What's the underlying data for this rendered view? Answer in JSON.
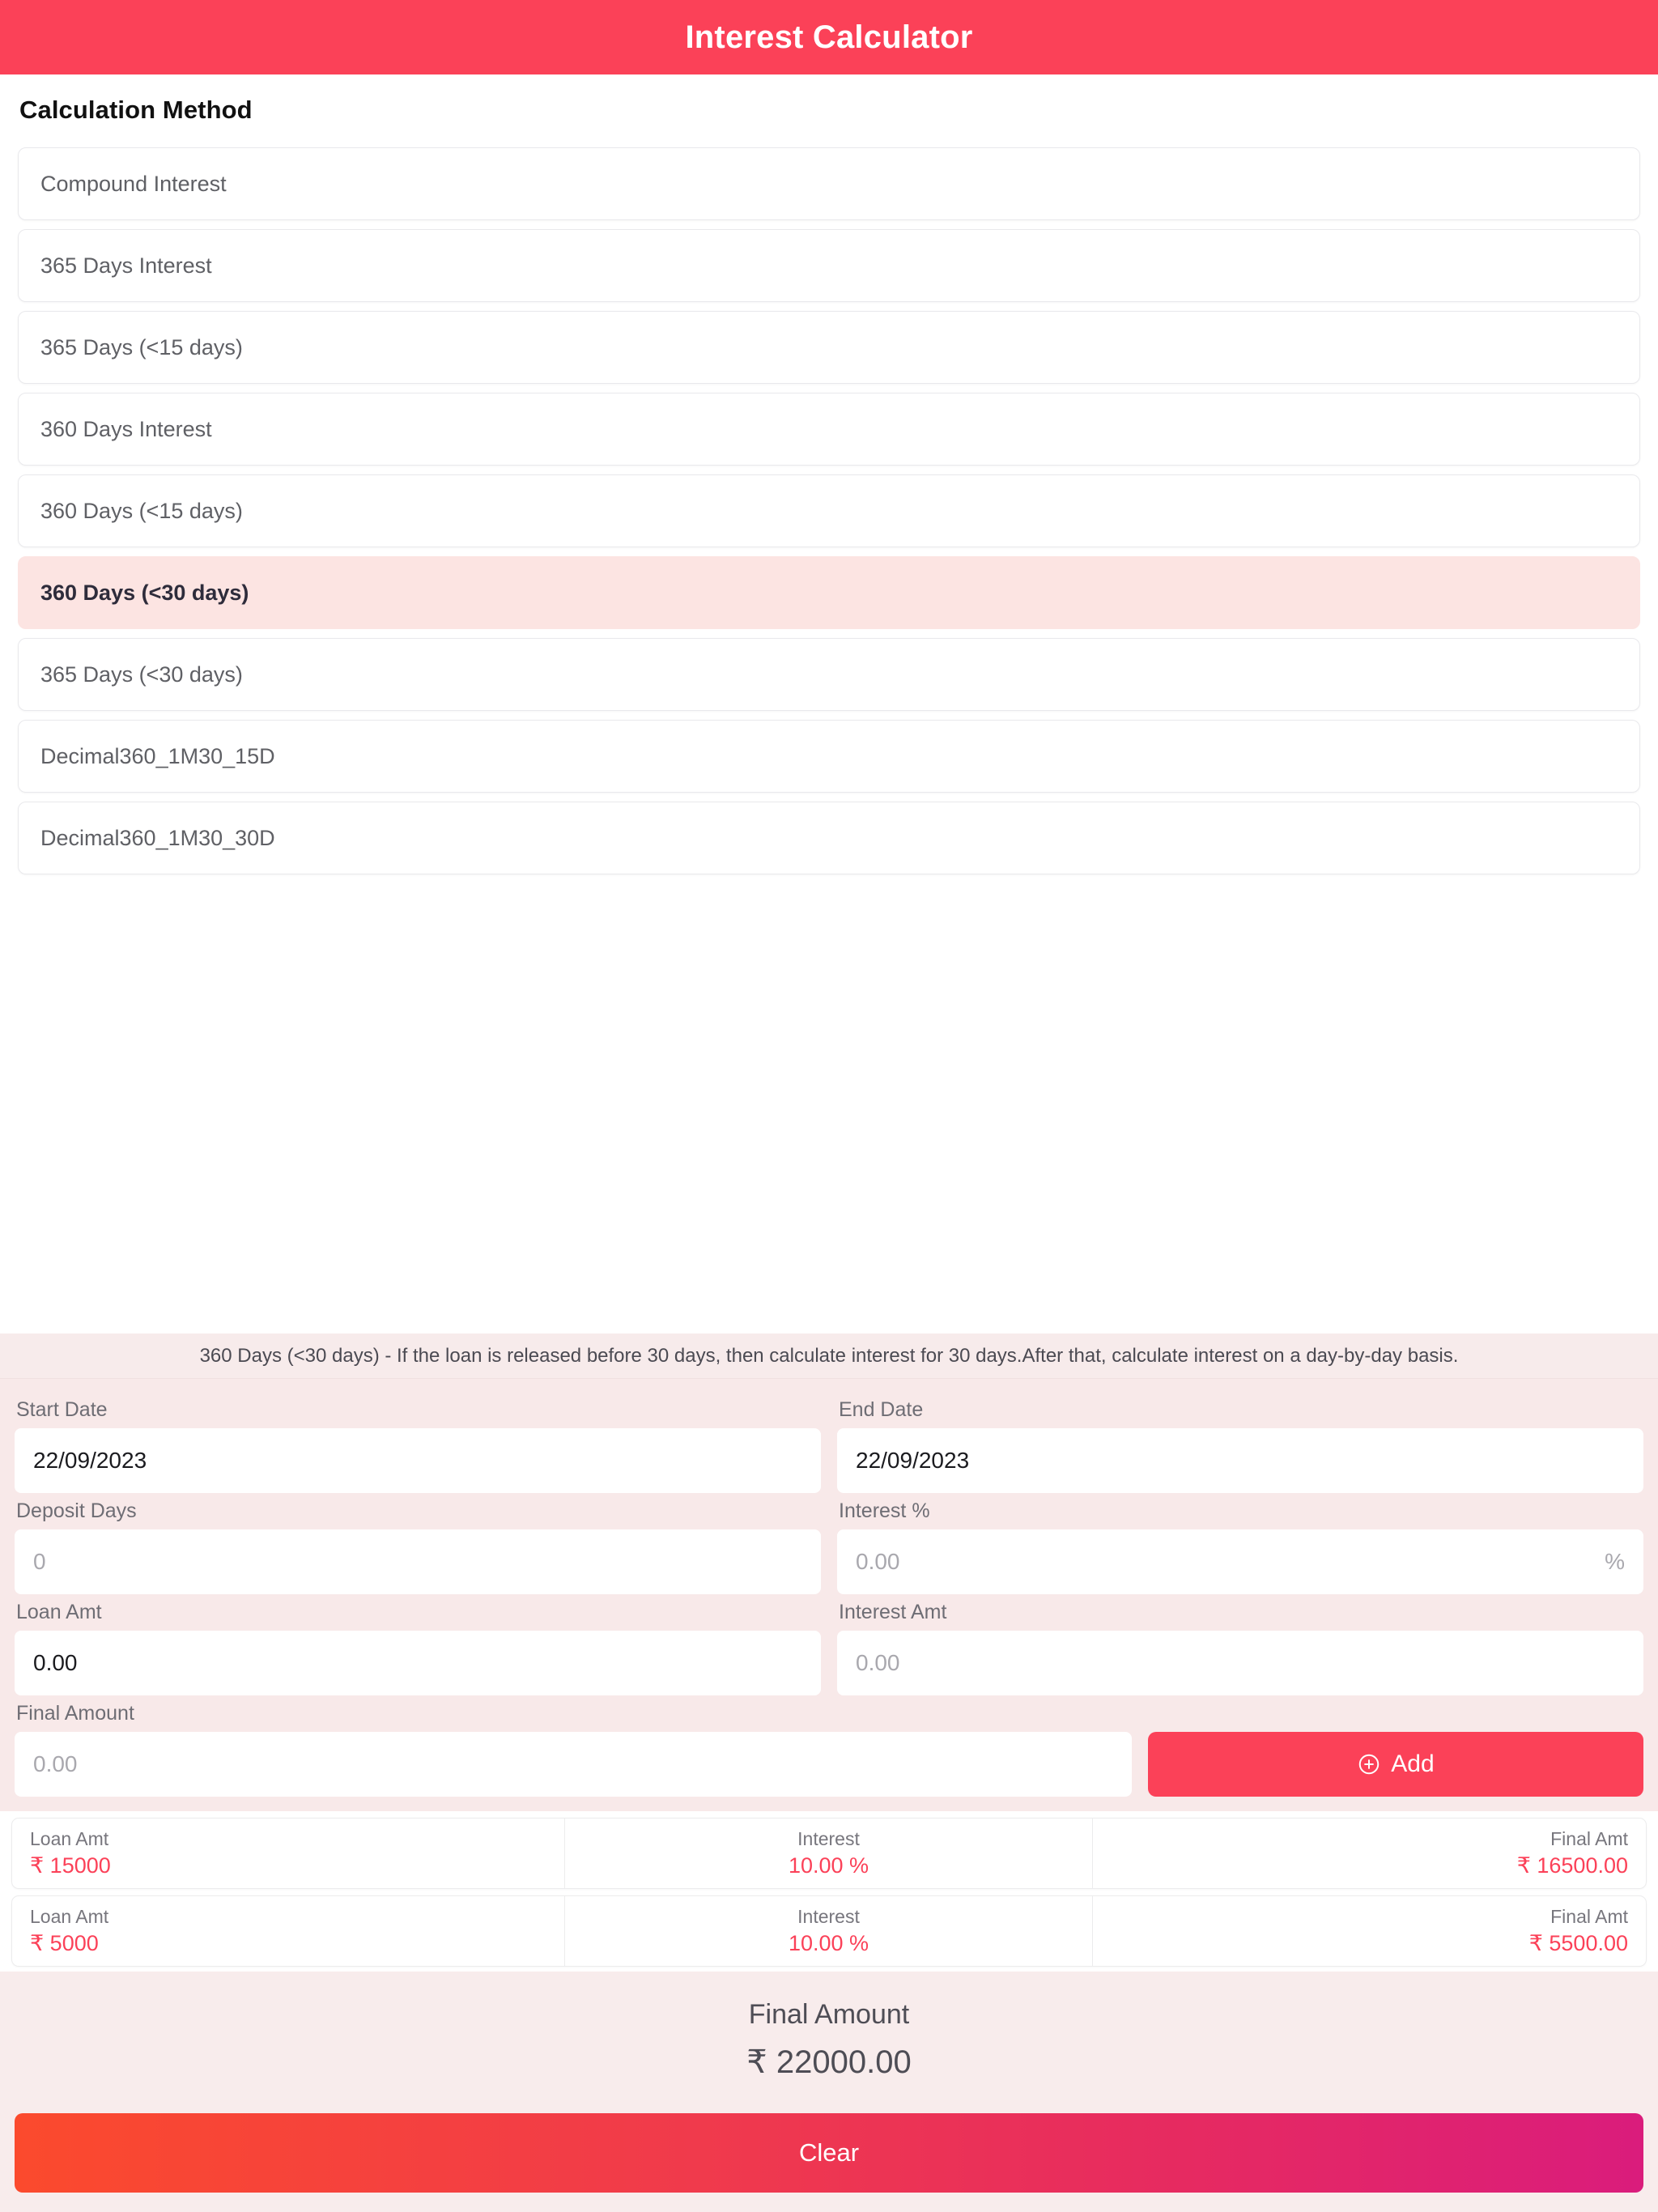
{
  "header": {
    "title": "Interest Calculator",
    "bg_color": "#fb4158"
  },
  "method_section": {
    "heading": "Calculation Method",
    "items": [
      {
        "label": "Compound Interest",
        "selected": false
      },
      {
        "label": "365 Days Interest",
        "selected": false
      },
      {
        "label": "365 Days (<15 days)",
        "selected": false
      },
      {
        "label": "360 Days Interest",
        "selected": false
      },
      {
        "label": "360 Days (<15 days)",
        "selected": false
      },
      {
        "label": "360 Days (<30 days)",
        "selected": true
      },
      {
        "label": "365 Days (<30 days)",
        "selected": false
      },
      {
        "label": "Decimal360_1M30_15D",
        "selected": false
      },
      {
        "label": "Decimal360_1M30_30D",
        "selected": false
      }
    ],
    "selected_label": "360 Days (<30 days)",
    "selected_bg_color": "#fce4e2"
  },
  "description": {
    "text": "360 Days (<30 days) - If the loan is released before 30 days, then calculate interest for 30 days.After that, calculate interest on a day-by-day basis."
  },
  "form": {
    "start_date": {
      "label": "Start Date",
      "value": "22/09/2023",
      "placeholder": ""
    },
    "end_date": {
      "label": "End Date",
      "value": "22/09/2023",
      "placeholder": ""
    },
    "deposit_days": {
      "label": "Deposit Days",
      "value": "",
      "placeholder": "0"
    },
    "interest_pct": {
      "label": "Interest %",
      "value": "",
      "placeholder": "0.00",
      "suffix": "%"
    },
    "loan_amt": {
      "label": "Loan Amt",
      "value": "0.00",
      "placeholder": "0.00"
    },
    "interest_amt": {
      "label": "Interest Amt",
      "value": "",
      "placeholder": "0.00"
    },
    "final_amount": {
      "label": "Final Amount",
      "value": "",
      "placeholder": "0.00"
    },
    "add_button": {
      "label": "Add",
      "icon": "plus-circle-icon",
      "bg_color": "#fb4158"
    }
  },
  "results": {
    "columns": [
      "Loan Amt",
      "Interest",
      "Final Amt"
    ],
    "rows": [
      {
        "loan_label": "Loan Amt",
        "loan_value": "₹ 15000",
        "interest_label": "Interest",
        "interest_value": "10.00 %",
        "final_label": "Final Amt",
        "final_value": "₹ 16500.00"
      },
      {
        "loan_label": "Loan Amt",
        "loan_value": "₹ 5000",
        "interest_label": "Interest",
        "interest_value": "10.00 %",
        "final_label": "Final Amt",
        "final_value": "₹ 5500.00"
      }
    ],
    "value_color": "#fb4158"
  },
  "footer": {
    "total_label": "Final Amount",
    "total_value": "₹ 22000.00",
    "clear_button": {
      "label": "Clear",
      "gradient_from": "#fb4a2d",
      "gradient_to": "#da1c7c"
    }
  }
}
